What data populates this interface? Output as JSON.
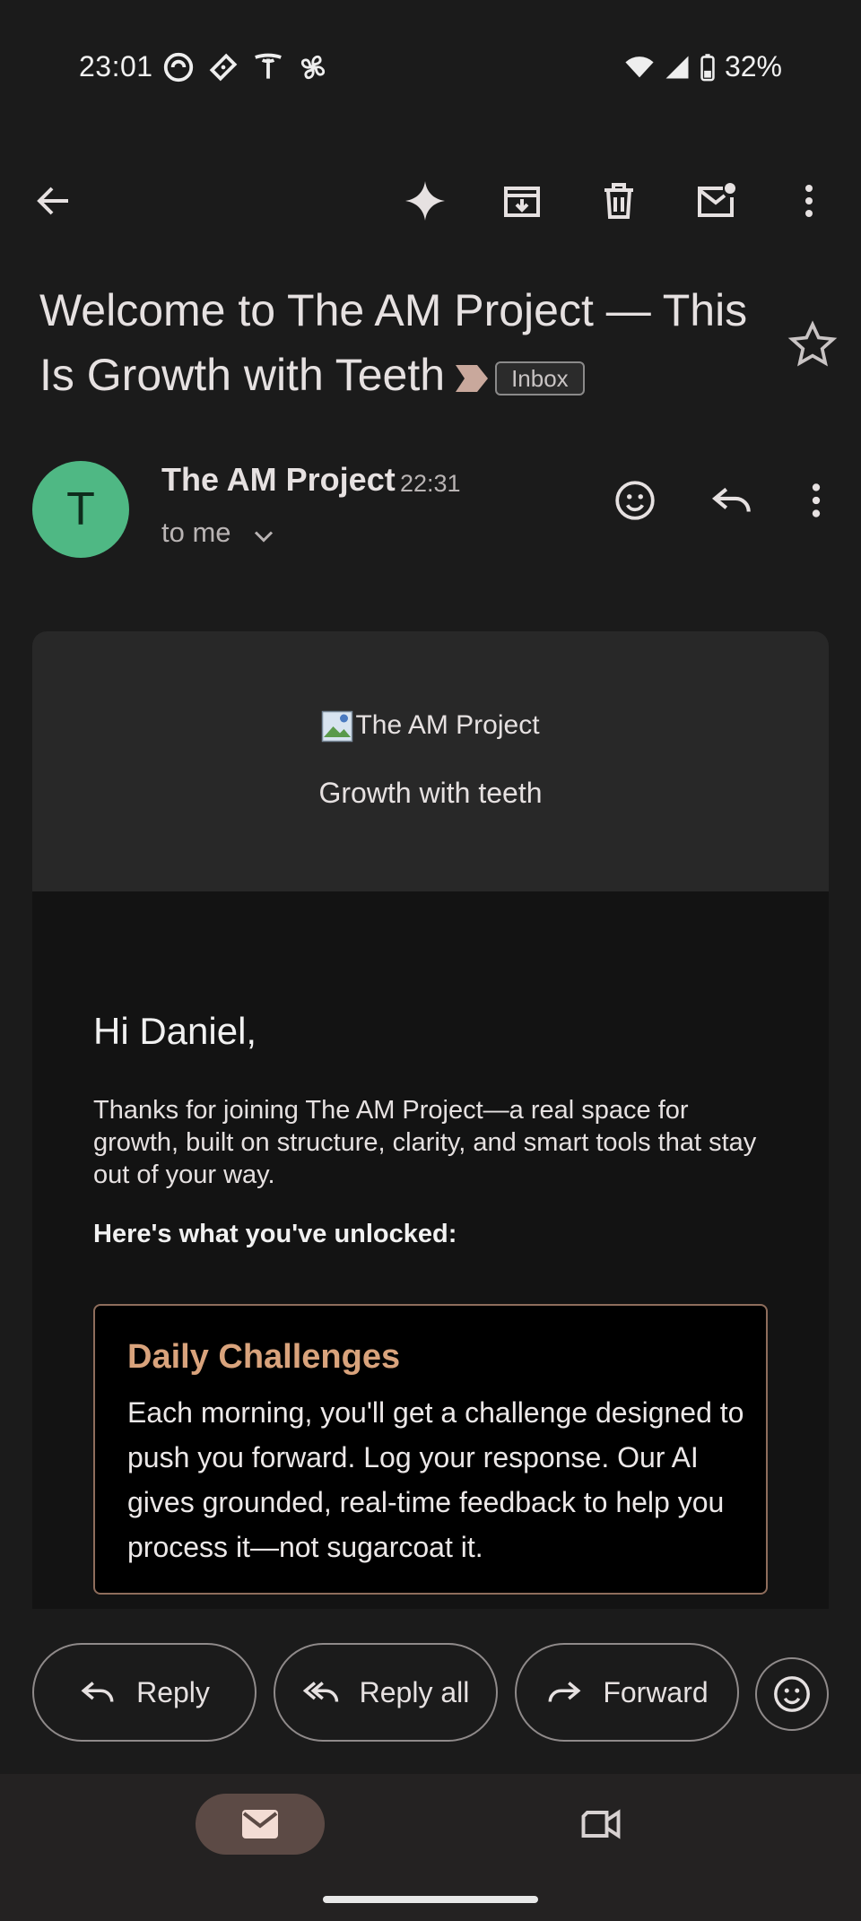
{
  "status_bar": {
    "time": "23:01",
    "battery": "32%",
    "icons": [
      "notification-app-icon",
      "ticket-icon",
      "tesla-icon",
      "fan-icon",
      "wifi-icon",
      "signal-icon",
      "battery-icon"
    ]
  },
  "toolbar": {
    "back": "arrow-back-icon",
    "actions": [
      "gemini-sparkle-icon",
      "archive-icon",
      "delete-icon",
      "mark-unread-icon",
      "more-vert-icon"
    ]
  },
  "email": {
    "subject": "Welcome to The AM Project — This Is Growth with Teeth",
    "label": "Inbox",
    "sender": {
      "initial": "T",
      "name": "The AM Project",
      "time": "22:31",
      "recipient": "to me",
      "avatar_color": "#4fb884"
    },
    "body": {
      "logo_alt": "The AM Project",
      "tagline": "Growth with teeth",
      "greeting": "Hi Daniel,",
      "intro": "Thanks for joining The AM Project—a real space for growth, built on structure, clarity, and smart tools that stay out of your way.",
      "unlocked_heading": "Here's what you've unlocked:",
      "feature": {
        "title": "Daily Challenges",
        "text": "Each morning, you'll get a challenge designed to push you forward. Log your response. Our AI gives grounded, real-time feedback to help you process it—not sugarcoat it.",
        "accent_color": "#d9a37c"
      }
    }
  },
  "actions": {
    "reply": "Reply",
    "reply_all": "Reply all",
    "forward": "Forward"
  },
  "bottom_nav": {
    "items": [
      "mail-icon",
      "video-call-icon"
    ],
    "selected": "mail"
  }
}
